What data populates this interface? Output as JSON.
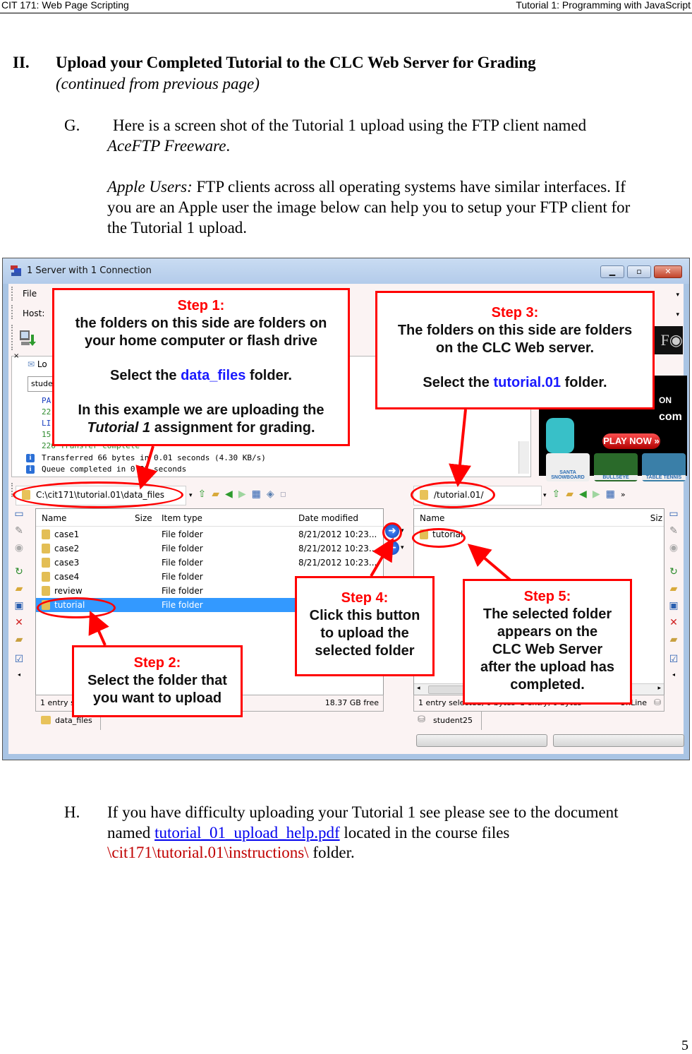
{
  "header": {
    "left": "CIT 171: Web Page Scripting",
    "right": "Tutorial 1: Programming with JavaScript"
  },
  "section": {
    "number": "II.",
    "title": "Upload your Completed Tutorial to the CLC Web Server for Grading",
    "subtitle": "(continued from previous page)"
  },
  "item_g": {
    "letter": "G.",
    "text_line1": "Here is a screen shot of the Tutorial 1 upload using the FTP client named",
    "client_name": "AceFTP Freeware",
    "period": ".",
    "apple_label": "Apple Users:",
    "apple_text1": " FTP clients across all operating systems have similar interfaces. If",
    "apple_text2": "you are an Apple user the image below can help you to setup your FTP client for",
    "apple_text3": "the Tutorial 1 upload."
  },
  "screenshot": {
    "window_title": "1 Server with 1 Connection",
    "menu_file": "File",
    "host_label": "Host:",
    "log_tab_partial": "Lo",
    "log_input_partial": "stude",
    "log_lines": [
      {
        "text": "PA",
        "color": "#1a3fbf"
      },
      {
        "text": "22",
        "color": "#2e8b2e"
      },
      {
        "text": "LI",
        "color": "#1a3fbf"
      },
      {
        "text": "15",
        "color": "#2e8b2e"
      },
      {
        "text": "226 Transfer complete",
        "color": "#2e8b2e"
      }
    ],
    "info_lines": [
      "Transferred 66 bytes in 0.01 seconds (4.30 KB/s)",
      "Queue completed in 0.25 seconds"
    ],
    "ad": {
      "partial_text1": "ON",
      "partial_text2": "com",
      "play_now": "PLAY NOW »",
      "thumbs": [
        "SANTA SNOWBOARD",
        "BULLSEYE",
        "TABLE TENNIS"
      ]
    },
    "local": {
      "path": "C:\\cit171\\tutorial.01\\data_files",
      "columns": [
        "Name",
        "Size",
        "Item type",
        "Date modified"
      ],
      "rows": [
        {
          "name": "case1",
          "type": "File folder",
          "date": "8/21/2012 10:23..."
        },
        {
          "name": "case2",
          "type": "File folder",
          "date": "8/21/2012 10:23..."
        },
        {
          "name": "case3",
          "type": "File folder",
          "date": "8/21/2012 10:23..."
        },
        {
          "name": "case4",
          "type": "File folder",
          "date": ""
        },
        {
          "name": "review",
          "type": "File folder",
          "date": ""
        },
        {
          "name": "tutorial",
          "type": "File folder",
          "date": "",
          "selected": true
        }
      ],
      "status_left": "1 entry s",
      "status_right": "18.37 GB free",
      "tab": "data_files"
    },
    "remote": {
      "path": "/tutorial.01/",
      "columns": [
        "Name",
        "Siz"
      ],
      "rows": [
        {
          "name": "tutorial"
        }
      ],
      "status1": "1 entry selected, 0 bytes",
      "status2": "1 entry, 0 bytes",
      "status3": "OnLine",
      "tab": "student25"
    },
    "callouts": {
      "step1": {
        "title": "Step 1:",
        "line1": "the folders on this side are folders on",
        "line2": "your home computer or flash drive",
        "line3a": "Select the ",
        "line3b": "data_files",
        "line3c": " folder.",
        "line4": "In this example we are uploading the",
        "line5a": "Tutorial 1",
        "line5b": " assignment for grading."
      },
      "step2": {
        "title": "Step 2:",
        "line1": "Select the folder that",
        "line2": "you want to upload"
      },
      "step3": {
        "title": "Step 3:",
        "line1": "The folders on this side are folders",
        "line2": "on the CLC Web server.",
        "line3a": "Select the ",
        "line3b": "tutorial.01",
        "line3c": " folder."
      },
      "step4": {
        "title": "Step 4:",
        "line1": "Click this button",
        "line2": "to upload the",
        "line3": "selected folder"
      },
      "step5": {
        "title": "Step 5:",
        "line1": "The selected folder",
        "line2": "appears on the",
        "line3": "CLC Web Server",
        "line4": "after the upload has",
        "line5": "completed."
      }
    }
  },
  "item_h": {
    "letter": "H.",
    "text1": "If you have difficulty uploading your Tutorial 1 see please see to the document",
    "text2a": "named ",
    "link": "tutorial_01_upload_help.pdf",
    "text2b": " located in the course files",
    "path": "\\cit171\\tutorial.01\\instructions\\",
    "text3": " folder."
  },
  "page_number": "5"
}
